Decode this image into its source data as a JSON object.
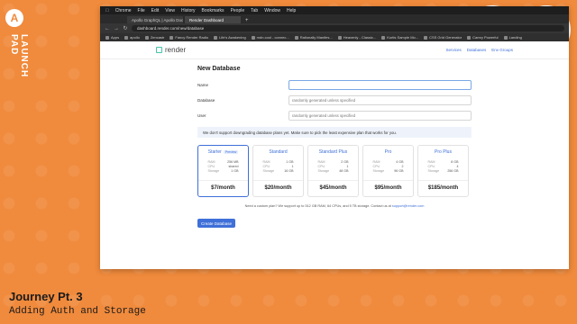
{
  "brand": {
    "logo_letter": "A",
    "name": "LAUNCH PAD"
  },
  "caption": {
    "title": "Journey Pt. 3",
    "subtitle": "Adding Auth and Storage"
  },
  "mac_menu": [
    "Chrome",
    "File",
    "Edit",
    "View",
    "History",
    "Bookmarks",
    "People",
    "Tab",
    "Window",
    "Help"
  ],
  "tabs": [
    {
      "label": "Apollo GraphQL | Apollo Docs",
      "active": false
    },
    {
      "label": "Render Dashboard",
      "active": true
    }
  ],
  "address": {
    "url": "dashboard.render.com/new/database"
  },
  "bookmarks": [
    "Apps",
    "apollo",
    "Zencastr",
    "Fancy Render Radio",
    "Life's Awakening",
    "mdn.cool - connec...",
    "Rationally Manifes...",
    "Heavenly - Classic...",
    "Kurtis Sample Mo...",
    "CSS Grid Generator",
    "Camry Powerful",
    "Landing"
  ],
  "render": {
    "logo": "render",
    "nav": [
      "Services",
      "Databases",
      "Env Groups"
    ]
  },
  "form": {
    "title": "New Database",
    "name_label": "Name",
    "name_placeholder": "",
    "database_label": "Database",
    "database_placeholder": "randomly generated unless specified",
    "user_label": "User",
    "user_placeholder": "randomly generated unless specified"
  },
  "notice": "We don't support downgrading database plans yet. Make sure to pick the least expensive plan that works for you.",
  "plans": [
    {
      "name": "Starter",
      "badge": "Preview",
      "ram": "256 MB",
      "cpu": "shared",
      "storage": "1 GB",
      "price": "$7/month",
      "selected": true
    },
    {
      "name": "Standard",
      "ram": "1 GB",
      "cpu": "1",
      "storage": "16 GB",
      "price": "$20/month",
      "selected": false
    },
    {
      "name": "Standard Plus",
      "ram": "2 GB",
      "cpu": "1",
      "storage": "48 GB",
      "price": "$45/month",
      "selected": false
    },
    {
      "name": "Pro",
      "ram": "4 GB",
      "cpu": "2",
      "storage": "96 GB",
      "price": "$95/month",
      "selected": false
    },
    {
      "name": "Pro Plus",
      "ram": "8 GB",
      "cpu": "4",
      "storage": "256 GB",
      "price": "$185/month",
      "selected": false
    }
  ],
  "spec_labels": {
    "ram": "RAM",
    "cpu": "CPU",
    "storage": "Storage"
  },
  "custom_plan": {
    "text": "Need a custom plan? We support up to 512 GB RAM, 64 CPUs, and 5 TB storage. Contact us at",
    "email": "support@render.com"
  },
  "create_button": "Create Database"
}
